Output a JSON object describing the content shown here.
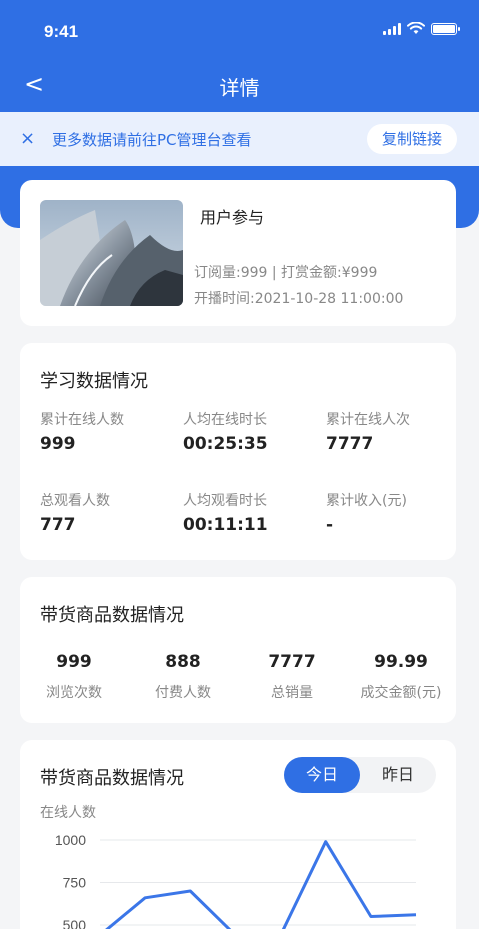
{
  "status_bar": {
    "time": "9:41"
  },
  "nav": {
    "back_glyph": "<",
    "title": "详情"
  },
  "notice": {
    "close_glyph": "×",
    "text": "更多数据请前往PC管理台查看",
    "copy_label": "复制链接"
  },
  "course": {
    "title": "用户参与",
    "meta_line1": "订阅量:999 | 打赏金额:¥999",
    "meta_line2": "开播时间:2021-10-28 11:00:00"
  },
  "learning": {
    "title": "学习数据情况",
    "stats": [
      {
        "label": "累计在线人数",
        "value": "999"
      },
      {
        "label": "人均在线时长",
        "value": "00:25:35"
      },
      {
        "label": "累计在线人次",
        "value": "7777"
      },
      {
        "label": "总观看人数",
        "value": "777"
      },
      {
        "label": "人均观看时长",
        "value": "00:11:11"
      },
      {
        "label": "累计收入(元)",
        "value": "-"
      }
    ]
  },
  "goods": {
    "title": "带货商品数据情况",
    "stats": [
      {
        "value": "999",
        "label": "浏览次数"
      },
      {
        "value": "888",
        "label": "付费人数"
      },
      {
        "value": "7777",
        "label": "总销量"
      },
      {
        "value": "99.99",
        "label": "成交金额(元)"
      }
    ]
  },
  "chart_section": {
    "title": "带货商品数据情况",
    "tabs": {
      "today": "今日",
      "yesterday": "昨日",
      "active": "today"
    }
  },
  "colors": {
    "primary": "#2f6fe4",
    "notice_bg": "#e9f0fd",
    "line": "#3b76e8"
  },
  "chart_data": {
    "type": "line",
    "ylabel": "在线人数",
    "yticks": [
      1000,
      750,
      500
    ],
    "ylim": [
      500,
      1000
    ],
    "x": [
      0,
      1,
      2,
      3,
      4,
      5,
      6,
      7
    ],
    "series": [
      {
        "values": [
          440,
          660,
          700,
          440,
          440,
          990,
          550,
          560
        ]
      }
    ],
    "grid": true
  }
}
